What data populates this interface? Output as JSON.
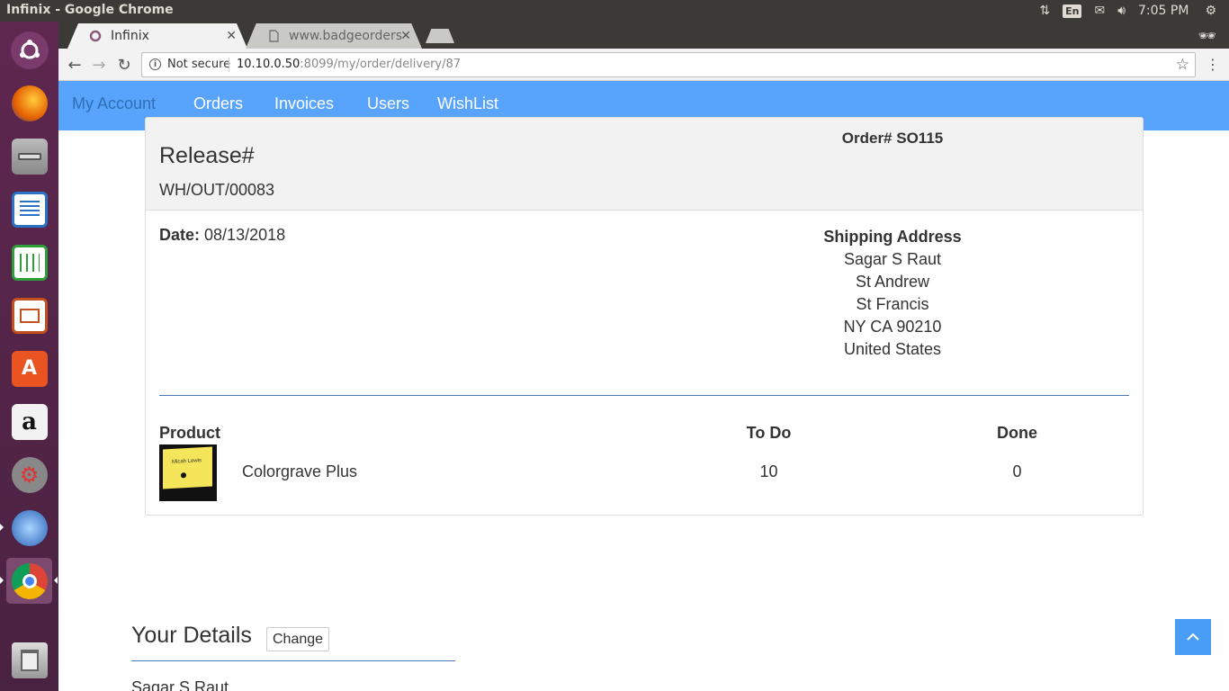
{
  "desktop": {
    "window_title": "Infinix - Google Chrome",
    "tray": {
      "language": "En",
      "time": "7:05 PM"
    },
    "launcher": [
      {
        "name": "ubuntu-dash"
      },
      {
        "name": "firefox"
      },
      {
        "name": "files"
      },
      {
        "name": "libreoffice-writer"
      },
      {
        "name": "libreoffice-calc"
      },
      {
        "name": "libreoffice-impress"
      },
      {
        "name": "ubuntu-software"
      },
      {
        "name": "amazon"
      },
      {
        "name": "system-settings"
      },
      {
        "name": "thunderbird"
      },
      {
        "name": "chrome"
      },
      {
        "name": "trash"
      }
    ]
  },
  "browser": {
    "tabs": [
      {
        "label": "Infinix",
        "active": true
      },
      {
        "label": "www.badgeorders",
        "active": false
      }
    ],
    "omnibox": {
      "security": "Not secure",
      "host": "10.10.0.50",
      "path": ":8099/my/order/delivery/87"
    }
  },
  "nav": {
    "items": [
      "My Account",
      "Orders",
      "Invoices",
      "Users",
      "WishList"
    ]
  },
  "delivery": {
    "release_label": "Release#",
    "release_ref": "WH/OUT/00083",
    "order_label": "Order# SO115",
    "date_label": "Date:",
    "date_value": "08/13/2018",
    "shipping": {
      "heading": "Shipping Address",
      "lines": [
        "Sagar S Raut",
        "St Andrew",
        "St Francis",
        "NY CA 90210",
        "United States"
      ]
    },
    "table": {
      "headers": [
        "Product",
        "To Do",
        "Done"
      ],
      "rows": [
        {
          "product": "Colorgrave Plus",
          "todo": "10",
          "done": "0",
          "thumb_text": "Micah Lewis"
        }
      ]
    }
  },
  "details": {
    "title": "Your Details",
    "change_label": "Change",
    "name": "Sagar S Raut"
  },
  "colors": {
    "nav_bg": "#58a3fb",
    "accent_line": "#4a78b8",
    "launcher": "#5e2750"
  }
}
